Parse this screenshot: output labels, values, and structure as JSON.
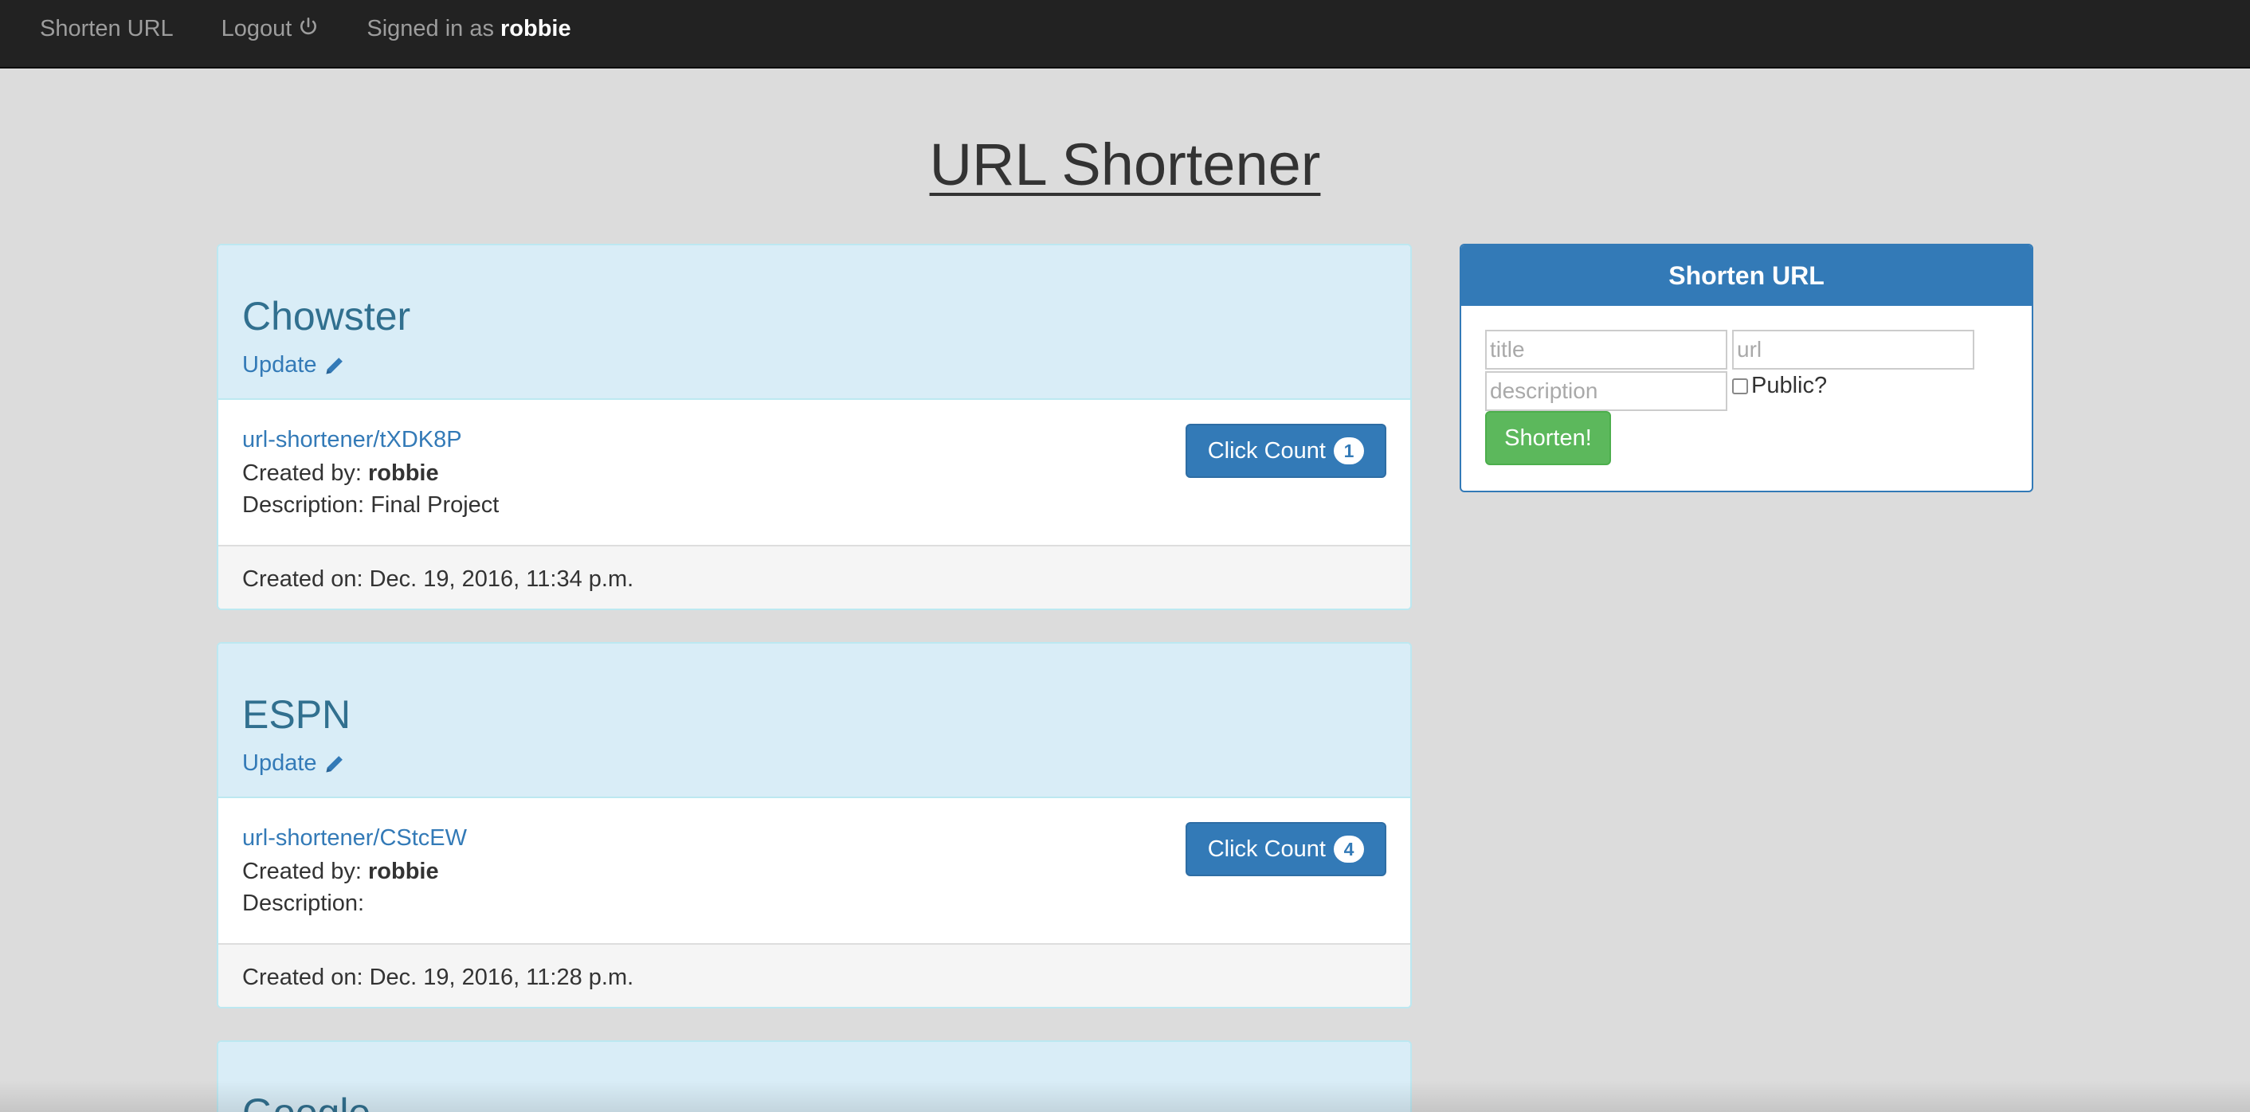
{
  "navbar": {
    "brand": "Shorten URL",
    "logout": "Logout",
    "signed_prefix": "Signed in as",
    "username": "robbie"
  },
  "page": {
    "title": "URL Shortener"
  },
  "cards": [
    {
      "title": "Chowster",
      "update_label": "Update",
      "short_url": "url-shortener/tXDK8P",
      "created_by_label": "Created by:",
      "created_by": "robbie",
      "description_label": "Description:",
      "description": "Final Project",
      "click_label": "Click Count",
      "click_count": "1",
      "created_on": "Created on: Dec. 19, 2016, 11:34 p.m."
    },
    {
      "title": "ESPN",
      "update_label": "Update",
      "short_url": "url-shortener/CStcEW",
      "created_by_label": "Created by:",
      "created_by": "robbie",
      "description_label": "Description:",
      "description": "",
      "click_label": "Click Count",
      "click_count": "4",
      "created_on": "Created on: Dec. 19, 2016, 11:28 p.m."
    },
    {
      "title": "Google"
    }
  ],
  "form": {
    "heading": "Shorten URL",
    "title_placeholder": "title",
    "url_placeholder": "url",
    "description_placeholder": "description",
    "public_label": "Public?",
    "submit_label": "Shorten!"
  },
  "colors": {
    "navbar": "#222222",
    "primary": "#337ab7",
    "success": "#5cb85c",
    "card_heading": "#d9edf7",
    "card_title": "#31708f",
    "page_bg": "#dcdcdc"
  }
}
